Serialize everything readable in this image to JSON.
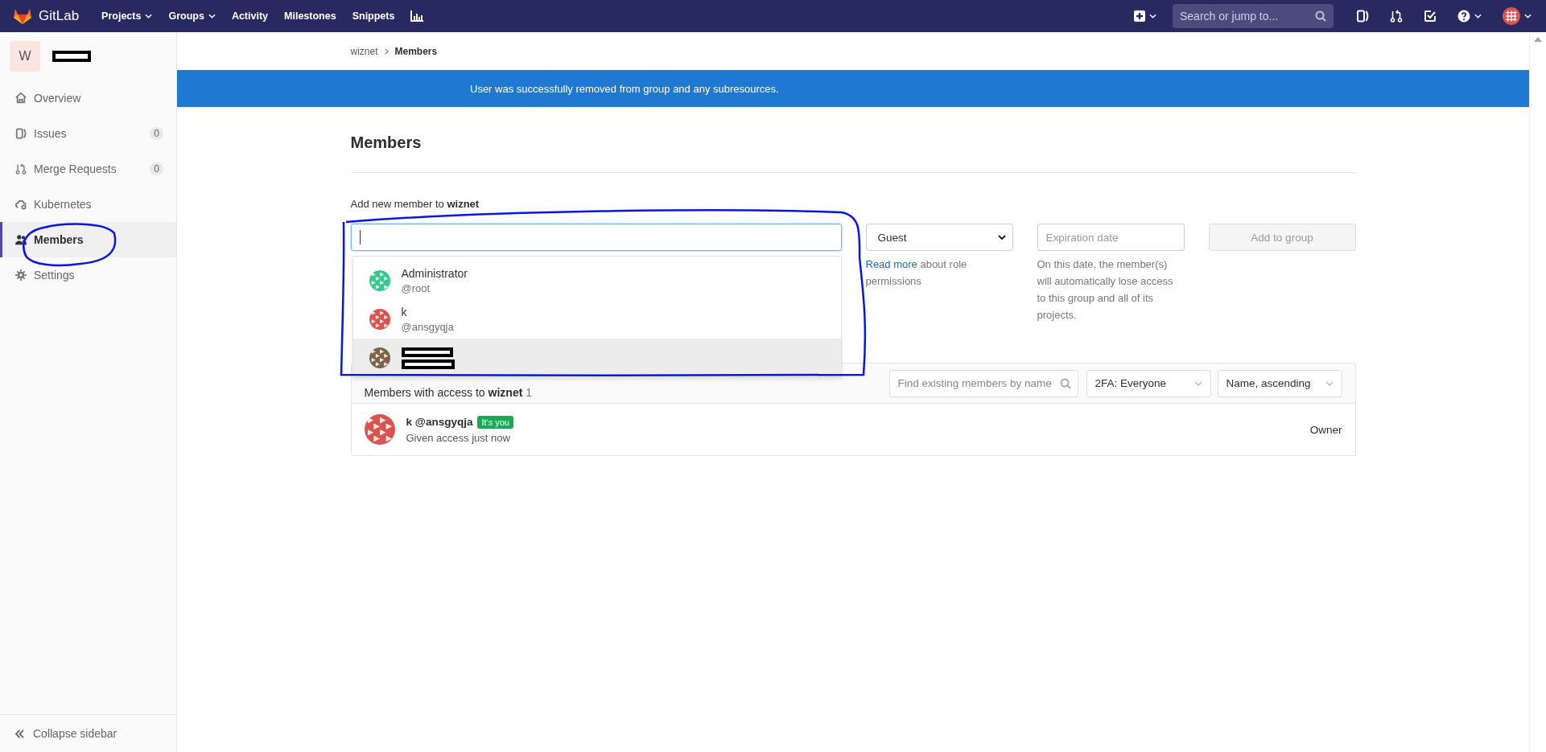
{
  "topbar": {
    "logo_text": "GitLab",
    "nav": [
      {
        "label": "Projects",
        "dropdown": true
      },
      {
        "label": "Groups",
        "dropdown": true
      },
      {
        "label": "Activity",
        "dropdown": false
      },
      {
        "label": "Milestones",
        "dropdown": false
      },
      {
        "label": "Snippets",
        "dropdown": false
      }
    ],
    "search": {
      "placeholder": "Search or jump to..."
    }
  },
  "sidebar": {
    "header": {
      "letter": "W",
      "name_redacted": true
    },
    "items": [
      {
        "label": "Overview",
        "kind": "home",
        "selected": false
      },
      {
        "label": "Issues",
        "kind": "issues",
        "count": "0",
        "selected": false
      },
      {
        "label": "Merge Requests",
        "kind": "merge",
        "count": "0",
        "selected": false
      },
      {
        "label": "Kubernetes",
        "kind": "cloud",
        "selected": false
      },
      {
        "label": "Members",
        "kind": "users",
        "selected": true
      },
      {
        "label": "Settings",
        "kind": "gear",
        "selected": false
      }
    ],
    "collapse": "Collapse sidebar"
  },
  "breadcrumb": [
    "wiznet",
    "Members"
  ],
  "alert": "User was successfully removed from group and any subresources.",
  "page_title": "Members",
  "add_member": {
    "label": "Add new member to **wiznet**",
    "input_focused": true,
    "suggestions": [
      {
        "kind": "user",
        "name": "Administrator",
        "username": "@root",
        "color": "#35c98f",
        "selected": false
      },
      {
        "kind": "user",
        "name": "k",
        "username": "@ansgyqja",
        "color": "#d9534f",
        "selected": false
      },
      {
        "kind": "redacted",
        "color": "#7d6449",
        "selected": true
      }
    ],
    "role": "Guest",
    "role_help_link": "Read more",
    "role_help": "about role permissions",
    "expiration_placeholder": "Expiration date",
    "expiration_help": "On this date, the member(s) will automatically lose access to this group and all of its projects.",
    "submit": {
      "label": "Add to group",
      "disabled": true
    }
  },
  "members_panel": {
    "title": "Members with access to **wiznet**",
    "count": "1",
    "filter_placeholder": "Find existing members by name",
    "twofa": "2FA: Everyone",
    "sort": "Name, ascending",
    "members": [
      {
        "name": "k",
        "username": "@ansgyqja",
        "badge": "It's you",
        "meta": "Given access just now",
        "role": "Owner",
        "color": "#d9534f"
      }
    ]
  }
}
